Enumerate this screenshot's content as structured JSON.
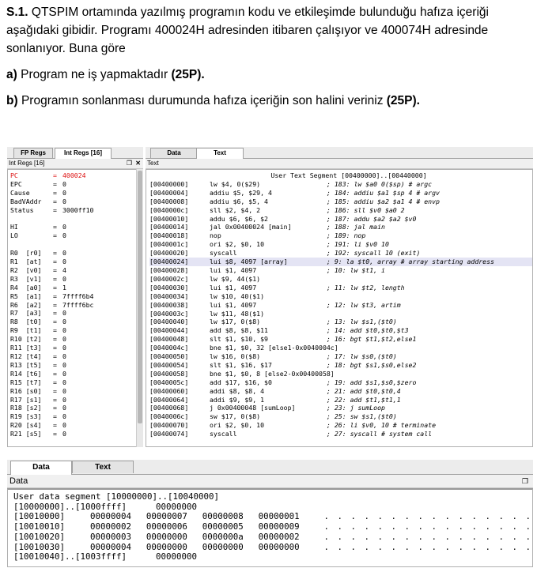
{
  "question": {
    "label": "S.1.",
    "text": "QTSPIM ortamında yazılmış programın kodu ve etkileşimde bulunduğu hafıza içeriği aşağıdaki gibidir. Programı 400024H adresinden itibaren çalışıyor ve 400074H adresinde sonlanıyor. Buna göre",
    "a_label": "a)",
    "a_text": "Program ne iş yapmaktadır",
    "a_points": "(25P).",
    "b_label": "b)",
    "b_text": "Programın sonlanması durumunda hafıza içeriğin son halini veriniz",
    "b_points": "(25P)."
  },
  "top_window": {
    "left_tabs": [
      "FP Regs",
      "Int Regs [16]"
    ],
    "right_tabs": [
      "Data",
      "Text"
    ],
    "regs_title": "Int Regs [16]",
    "text_title": "Text",
    "pane_icons": [
      "restore-icon",
      "close-icon"
    ],
    "registers": [
      {
        "name": "PC",
        "value": "400024",
        "pc": true
      },
      {
        "name": "EPC",
        "value": "0"
      },
      {
        "name": "Cause",
        "value": "0"
      },
      {
        "name": "BadVAddr",
        "value": "0"
      },
      {
        "name": "Status",
        "value": "3000ff10"
      },
      {
        "name": "",
        "value": ""
      },
      {
        "name": "HI",
        "value": "0"
      },
      {
        "name": "LO",
        "value": "0"
      },
      {
        "name": "",
        "value": ""
      },
      {
        "name": "R0  [r0]",
        "value": "0"
      },
      {
        "name": "R1  [at]",
        "value": "0"
      },
      {
        "name": "R2  [v0]",
        "value": "4"
      },
      {
        "name": "R3  [v1]",
        "value": "0"
      },
      {
        "name": "R4  [a0]",
        "value": "1"
      },
      {
        "name": "R5  [a1]",
        "value": "7ffff6b4"
      },
      {
        "name": "R6  [a2]",
        "value": "7ffff6bc"
      },
      {
        "name": "R7  [a3]",
        "value": "0"
      },
      {
        "name": "R8  [t0]",
        "value": "0"
      },
      {
        "name": "R9  [t1]",
        "value": "0"
      },
      {
        "name": "R10 [t2]",
        "value": "0"
      },
      {
        "name": "R11 [t3]",
        "value": "0"
      },
      {
        "name": "R12 [t4]",
        "value": "0"
      },
      {
        "name": "R13 [t5]",
        "value": "0"
      },
      {
        "name": "R14 [t6]",
        "value": "0"
      },
      {
        "name": "R15 [t7]",
        "value": "0"
      },
      {
        "name": "R16 [s0]",
        "value": "0"
      },
      {
        "name": "R17 [s1]",
        "value": "0"
      },
      {
        "name": "R18 [s2]",
        "value": "0"
      },
      {
        "name": "R19 [s3]",
        "value": "0"
      },
      {
        "name": "R20 [s4]",
        "value": "0"
      },
      {
        "name": "R21 [s5]",
        "value": "0"
      }
    ],
    "text_header": "User Text Segment [00400000]..[00440000]",
    "code": [
      {
        "addr": "[00400000]",
        "instr": "lw $4, 0($29)",
        "comment": "; 183: lw $a0 0($sp) # argc"
      },
      {
        "addr": "[00400004]",
        "instr": "addiu $5, $29, 4",
        "comment": "; 184: addiu $a1 $sp 4 # argv"
      },
      {
        "addr": "[00400008]",
        "instr": "addiu $6, $5, 4",
        "comment": "; 185: addiu $a2 $a1 4 # envp"
      },
      {
        "addr": "[0040000c]",
        "instr": "sll $2, $4, 2",
        "comment": "; 186: sll $v0 $a0 2"
      },
      {
        "addr": "[00400010]",
        "instr": "addu $6, $6, $2",
        "comment": "; 187: addu $a2 $a2 $v0"
      },
      {
        "addr": "[00400014]",
        "instr": "jal 0x00400024 [main]",
        "comment": "; 188: jal main"
      },
      {
        "addr": "[00400018]",
        "instr": "nop",
        "comment": "; 189: nop"
      },
      {
        "addr": "[0040001c]",
        "instr": "ori $2, $0, 10",
        "comment": "; 191: li $v0 10"
      },
      {
        "addr": "[00400020]",
        "instr": "syscall",
        "comment": "; 192: syscall 10 (exit)"
      },
      {
        "addr": "[00400024]",
        "instr": "lui $8, 4097 [array]",
        "comment": "; 9: la $t0, array # array starting address",
        "highlight": true
      },
      {
        "addr": "[00400028]",
        "instr": "lui $1, 4097",
        "comment": "; 10: lw $t1, i"
      },
      {
        "addr": "[0040002c]",
        "instr": "lw $9, 44($1)",
        "comment": ""
      },
      {
        "addr": "[00400030]",
        "instr": "lui $1, 4097",
        "comment": "; 11: lw $t2, length"
      },
      {
        "addr": "[00400034]",
        "instr": "lw $10, 40($1)",
        "comment": ""
      },
      {
        "addr": "[00400038]",
        "instr": "lui $1, 4097",
        "comment": "; 12: lw $t3, artim"
      },
      {
        "addr": "[0040003c]",
        "instr": "lw $11, 48($1)",
        "comment": ""
      },
      {
        "addr": "[00400040]",
        "instr": "lw $17, 0($8)",
        "comment": "; 13: lw $s1,($t0)"
      },
      {
        "addr": "[00400044]",
        "instr": "add $8, $8, $11",
        "comment": "; 14: add $t0,$t0,$t3"
      },
      {
        "addr": "[00400048]",
        "instr": "slt $1, $10, $9",
        "comment": "; 16: bgt $t1,$t2,else1"
      },
      {
        "addr": "[0040004c]",
        "instr": "bne $1, $0, 32 [else1-0x0040004c]",
        "comment": ""
      },
      {
        "addr": "[00400050]",
        "instr": "lw $16, 0($8)",
        "comment": "; 17: lw $s0,($t0)"
      },
      {
        "addr": "[00400054]",
        "instr": "slt $1, $16, $17",
        "comment": "; 18: bgt $s1,$s0,else2"
      },
      {
        "addr": "[00400058]",
        "instr": "bne $1, $0, 8 [else2-0x00400058]",
        "comment": ""
      },
      {
        "addr": "[0040005c]",
        "instr": "add $17, $16, $0",
        "comment": "; 19: add $s1,$s0,$zero"
      },
      {
        "addr": "[00400060]",
        "instr": "addi $8, $8, 4",
        "comment": "; 21: add $t0,$t0,4"
      },
      {
        "addr": "[00400064]",
        "instr": "addi $9, $9, 1",
        "comment": "; 22: add $t1,$t1,1"
      },
      {
        "addr": "[00400068]",
        "instr": "j 0x00400048 [sumLoop]",
        "comment": "; 23: j sumLoop"
      },
      {
        "addr": "[0040006c]",
        "instr": "sw $17, 0($8)",
        "comment": "; 25: sw $s1,($t0)"
      },
      {
        "addr": "[00400070]",
        "instr": "ori $2, $0, 10",
        "comment": "; 26: li $v0, 10 # terminate"
      },
      {
        "addr": "[00400074]",
        "instr": "syscall",
        "comment": "; 27: syscall # system call"
      }
    ]
  },
  "bottom_window": {
    "tabs": [
      "Data",
      "Text"
    ],
    "title": "Data",
    "header": "User data segment [10000000]..[10040000]",
    "rows": [
      {
        "addr": "[10000000]..[1000ffff]",
        "values": [
          "00000000"
        ],
        "dots": ""
      },
      {
        "addr": "[10010000]",
        "values": [
          "00000004",
          "00000007",
          "00000008",
          "00000001"
        ],
        "dots": ". . . . . . . . . . . . . . . ."
      },
      {
        "addr": "[10010010]",
        "values": [
          "00000002",
          "00000006",
          "00000005",
          "00000009"
        ],
        "dots": ". . . . . . . . . . . . . . . ."
      },
      {
        "addr": "[10010020]",
        "values": [
          "00000003",
          "00000000",
          "0000000a",
          "00000002"
        ],
        "dots": ". . . . . . . . . . . . . . . ."
      },
      {
        "addr": "[10010030]",
        "values": [
          "00000004",
          "00000000",
          "00000000",
          "00000000"
        ],
        "dots": ". . . . . . . . . . . . . . . ."
      },
      {
        "addr": "[10010040]..[1003ffff]",
        "values": [
          "00000000"
        ],
        "dots": ""
      }
    ]
  }
}
